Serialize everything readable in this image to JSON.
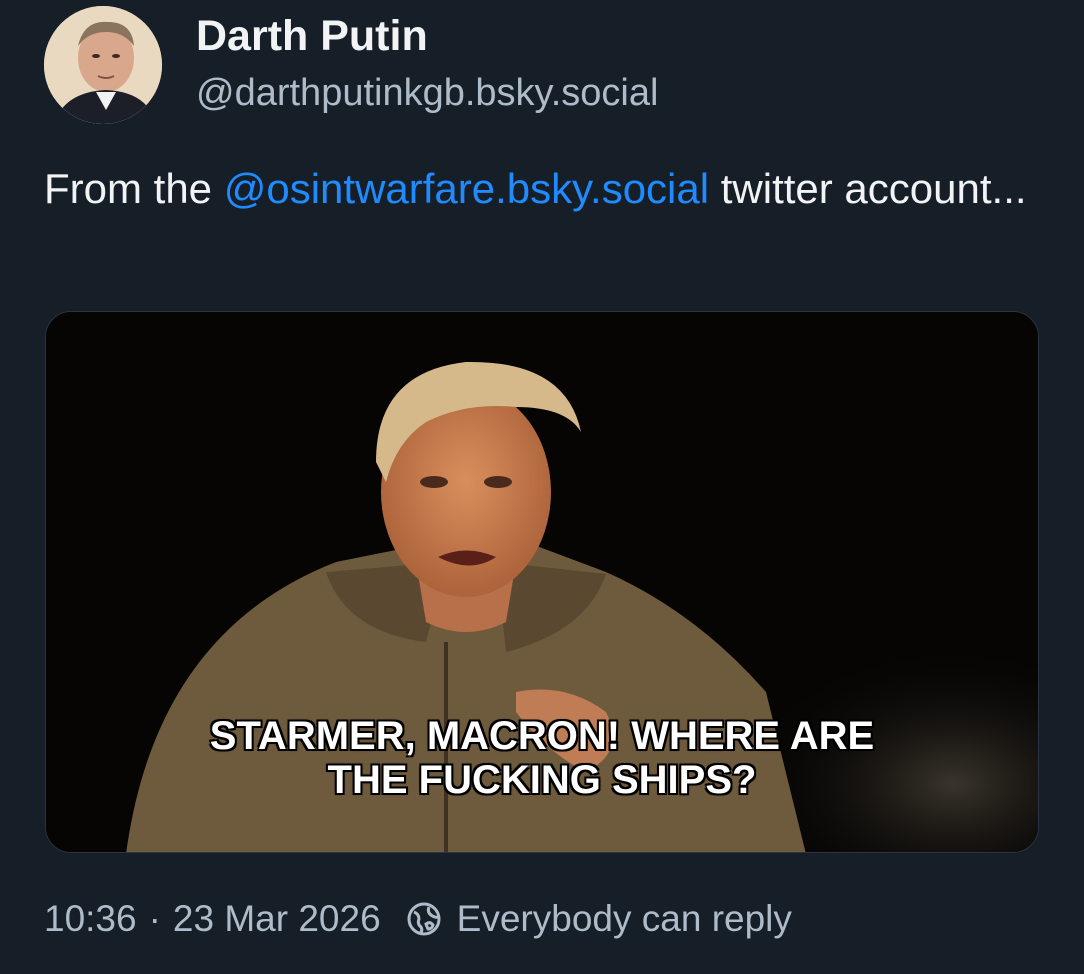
{
  "author": {
    "display_name": "Darth Putin",
    "handle": "@darthputinkgb.bsky.social",
    "avatar_icon": "avatar-photo"
  },
  "post": {
    "text_before": "From the ",
    "mention": "@osintwarfare.bsky.social",
    "text_after": " twitter account..."
  },
  "media": {
    "caption_line1": "STARMER, MACRON! WHERE ARE",
    "caption_line2": "THE FUCKING SHIPS?"
  },
  "footer": {
    "time": "10:36",
    "separator": "·",
    "date": "23 Mar 2026",
    "reply_icon": "globe-icon",
    "reply_label": "Everybody can reply"
  },
  "colors": {
    "background": "#161e27",
    "text": "#f1f3f5",
    "muted": "#aebbc9",
    "link": "#208bfe"
  }
}
